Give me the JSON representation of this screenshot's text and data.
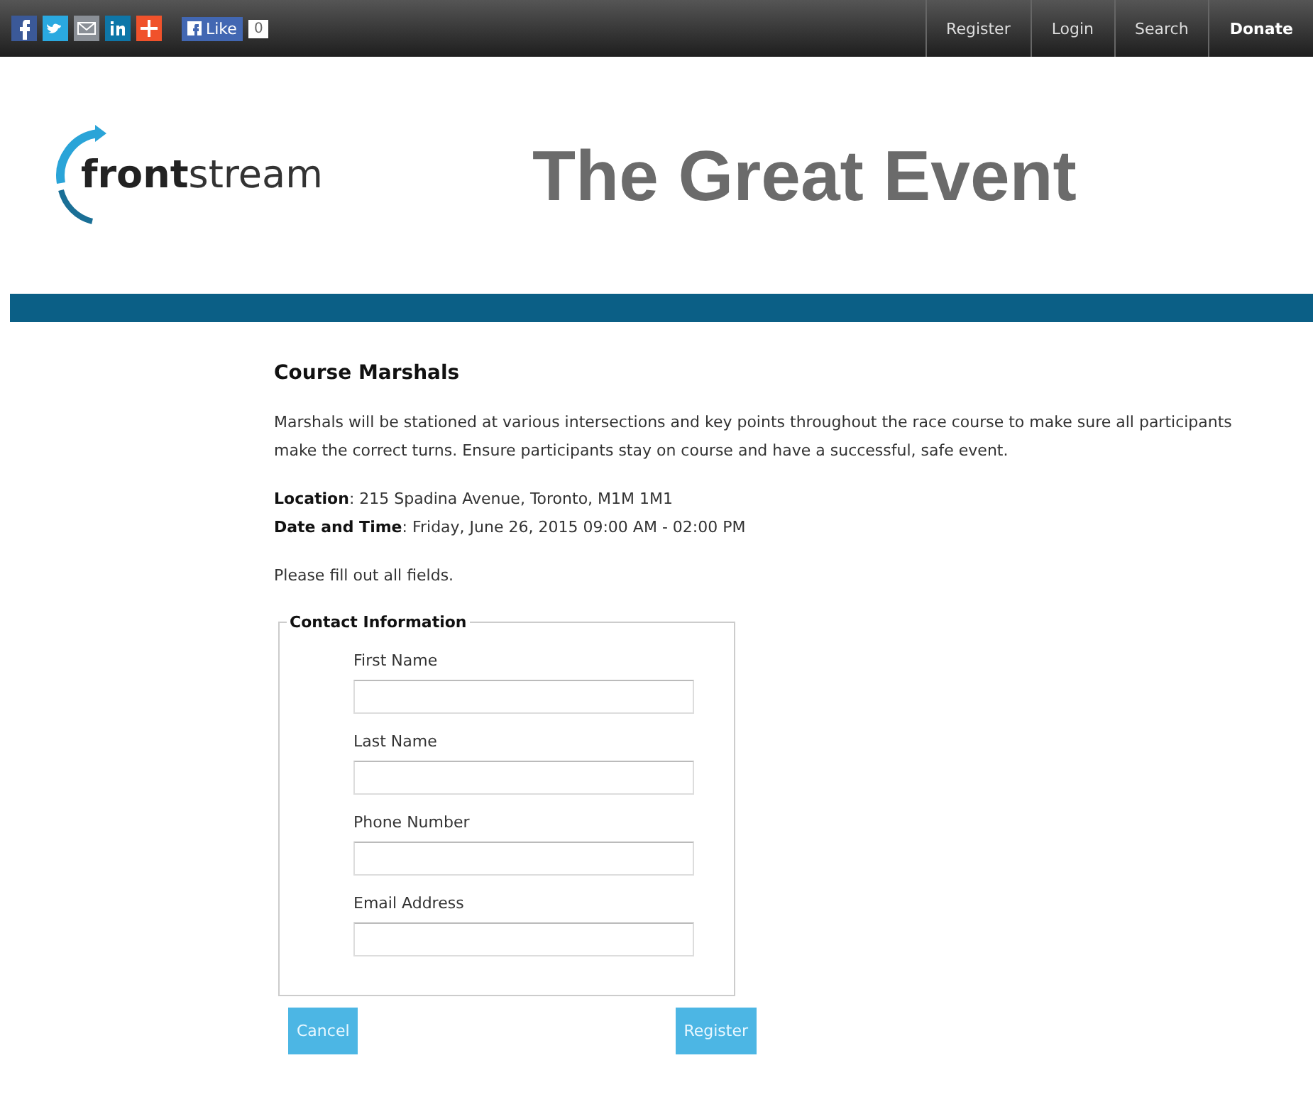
{
  "top_bar": {
    "share_icons": [
      {
        "kind": "facebook",
        "color": "#3b5998"
      },
      {
        "kind": "twitter",
        "color": "#2aa9e0"
      },
      {
        "kind": "email",
        "color": "#8a8f96"
      },
      {
        "kind": "linkedin",
        "color": "#0e76a8"
      },
      {
        "kind": "plus",
        "color": "#f0522b"
      }
    ],
    "like_button": {
      "label": "Like",
      "count": "0"
    },
    "nav": [
      "Register",
      "Login",
      "Search",
      "Donate"
    ]
  },
  "header": {
    "logo": "**front**stream",
    "title": "The Great Event"
  },
  "content": {
    "heading": "Course Marshals",
    "description": "Marshals will be stationed at various intersections and key points throughout the race course to make sure all participants make the correct turns. Ensure participants stay on course and have a successful, safe event.",
    "details": [
      "**Location**: 215 Spadina Avenue, Toronto, M1M 1M1",
      "**Date and Time**: Friday, June 26, 2015 09:00 AM - 02:00 PM"
    ],
    "instruction": "Please fill out all fields.",
    "form": {
      "legend": "Contact Information",
      "fields": [
        {
          "label": "First Name"
        },
        {
          "label": "Last Name"
        },
        {
          "label": "Phone Number"
        },
        {
          "label": "Email Address"
        }
      ]
    },
    "buttons": [
      "Cancel",
      "Register"
    ]
  }
}
